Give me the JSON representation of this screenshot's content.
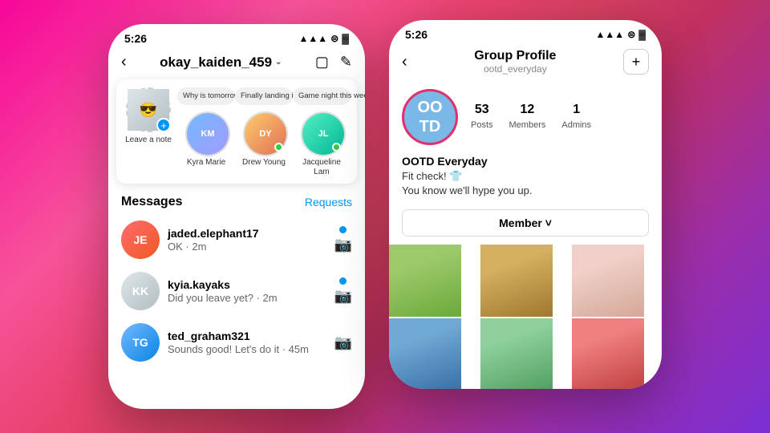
{
  "background": {
    "gradient": "135deg, #f7069a 0%, #c03060 50%, #7b2fd4 100%"
  },
  "left_phone": {
    "status_bar": {
      "time": "5:26",
      "signal": "▲▲▲",
      "wifi": "wifi",
      "battery": "battery"
    },
    "nav": {
      "back_label": "<",
      "username": "okay_kaiden_459",
      "chevron": "˅",
      "video_icon": "video",
      "edit_icon": "edit"
    },
    "stories": [
      {
        "id": "self",
        "name": "Leave a note",
        "has_add": true,
        "bubble": null
      },
      {
        "id": "kyia",
        "name": "Kyra Marie",
        "has_add": false,
        "bubble": "Why is tomorrow Monday!? 😅",
        "online": false
      },
      {
        "id": "drew",
        "name": "Drew Young",
        "has_add": false,
        "bubble": "Finally landing in NYC! ❤️",
        "online": true
      },
      {
        "id": "jacq",
        "name": "Jacqueline Lam",
        "has_add": false,
        "bubble": "Game night this weekend? 🎲",
        "online": true
      }
    ],
    "messages_section": {
      "title": "Messages",
      "requests_label": "Requests"
    },
    "messages": [
      {
        "username": "jaded.elephant17",
        "preview": "OK · 2m",
        "unread": true,
        "color": "red"
      },
      {
        "username": "kyia.kayaks",
        "preview": "Did you leave yet? · 2m",
        "unread": true,
        "color": "grey"
      },
      {
        "username": "ted_graham321",
        "preview": "Sounds good! Let's do it · 45m",
        "unread": false,
        "color": "blue"
      }
    ]
  },
  "right_phone": {
    "status_bar": {
      "time": "5:26",
      "signal": "▲▲▲",
      "wifi": "wifi",
      "battery": "battery"
    },
    "nav": {
      "back_icon": "<",
      "title": "Group Profile",
      "subtitle": "ootd_everyday",
      "add_icon": "+"
    },
    "group": {
      "avatar_text": "OO\nTD",
      "stats": [
        {
          "number": "53",
          "label": "Posts"
        },
        {
          "number": "12",
          "label": "Members"
        },
        {
          "number": "1",
          "label": "Admins"
        }
      ],
      "bio_name": "OOTD Everyday",
      "bio_lines": [
        "Fit check! 👕",
        "You know we'll hype you up."
      ],
      "member_button": "Member ˅"
    },
    "photos": [
      {
        "id": 1,
        "color": "#8bc34a"
      },
      {
        "id": 2,
        "color": "#d4a04a"
      },
      {
        "id": 3,
        "color": "#e8c4b8"
      },
      {
        "id": 4,
        "color": "#5c9bd6"
      },
      {
        "id": 5,
        "color": "#7bc67e"
      },
      {
        "id": 6,
        "color": "#e87070"
      }
    ]
  }
}
